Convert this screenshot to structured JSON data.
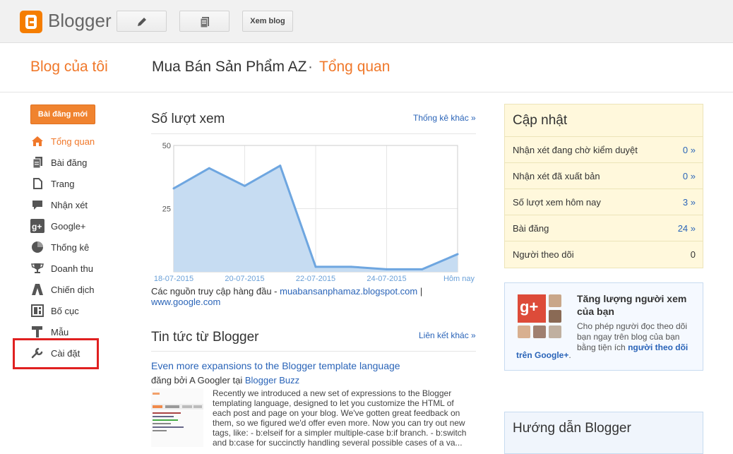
{
  "topbar": {
    "logo_text": "Blogger",
    "view_blog": "Xem blog"
  },
  "header": {
    "my_blogs": "Blog của tôi",
    "blog_name": "Mua Bán Sản Phẩm AZ",
    "separator": "·",
    "section": "Tổng quan"
  },
  "sidebar": {
    "new_post": "Bài đăng mới",
    "items": [
      {
        "label": "Tổng quan",
        "icon": "home-icon"
      },
      {
        "label": "Bài đăng",
        "icon": "posts-icon"
      },
      {
        "label": "Trang",
        "icon": "pages-icon"
      },
      {
        "label": "Nhận xét",
        "icon": "comments-icon"
      },
      {
        "label": "Google+",
        "icon": "google-plus-icon"
      },
      {
        "label": "Thống kê",
        "icon": "pie-chart-icon"
      },
      {
        "label": "Doanh thu",
        "icon": "trophy-icon"
      },
      {
        "label": "Chiến dịch",
        "icon": "campaign-icon"
      },
      {
        "label": "Bố cục",
        "icon": "layout-icon"
      },
      {
        "label": "Mẫu",
        "icon": "template-icon"
      },
      {
        "label": "Cài đặt",
        "icon": "wrench-icon"
      }
    ]
  },
  "pageviews": {
    "title": "Số lượt xem",
    "more_link": "Thống kê khác »",
    "sources_label": "Các nguồn truy cập hàng đầu - ",
    "source1": "muabansanphamaz.blogspot.com",
    "source_sep": " |",
    "source2": "www.google.com"
  },
  "chart_data": {
    "type": "area",
    "x": [
      "18-07-2015",
      "19-07-2015",
      "20-07-2015",
      "21-07-2015",
      "22-07-2015",
      "23-07-2015",
      "24-07-2015",
      "25-07-2015",
      "Hôm nay"
    ],
    "values": [
      33,
      41,
      34,
      42,
      2,
      2,
      1,
      1,
      7
    ],
    "tick_labels": [
      "18-07-2015",
      "20-07-2015",
      "22-07-2015",
      "24-07-2015",
      "Hôm nay"
    ],
    "y_ticks": [
      "50",
      "25"
    ],
    "ylim": [
      0,
      50
    ],
    "color": "#6ea6e0",
    "fill": "#c6dcf2"
  },
  "news": {
    "title": "Tin tức từ Blogger",
    "more_link": "Liên kết khác »",
    "post_title": "Even more expansions to the Blogger template language",
    "by_prefix": "đăng bởi A Googler tại ",
    "by_source": "Blogger Buzz",
    "body": "Recently we introduced a new set of expressions to the Blogger templating language, designed to let you customize the HTML of each post and page on your blog. We've gotten great feedback on them, so we figured we'd offer even more. Now you can try out new tags, like: - b:elseif for a simpler multiple-case b:if branch. - b:switch and b:case for succinctly handling several possible cases of a va..."
  },
  "updates": {
    "title": "Cập nhật",
    "rows": [
      {
        "label": "Nhận xét đang chờ kiểm duyệt",
        "value": "0 »"
      },
      {
        "label": "Nhận xét đã xuất bản",
        "value": "0 »"
      },
      {
        "label": "Số lượt xem hôm nay",
        "value": "3 »"
      },
      {
        "label": "Bài đăng",
        "value": "24 »"
      },
      {
        "label": "Người theo dõi",
        "value": "0"
      }
    ]
  },
  "gplus": {
    "title": "Tăng lượng người xem của bạn",
    "text": "Cho phép người đọc theo dõi bạn ngay trên blog của bạn bằng tiện ích ",
    "link1": "người theo dõi",
    "link2": "trên Google+",
    "end": "."
  },
  "guide": {
    "title": "Hướng dẫn Blogger"
  }
}
